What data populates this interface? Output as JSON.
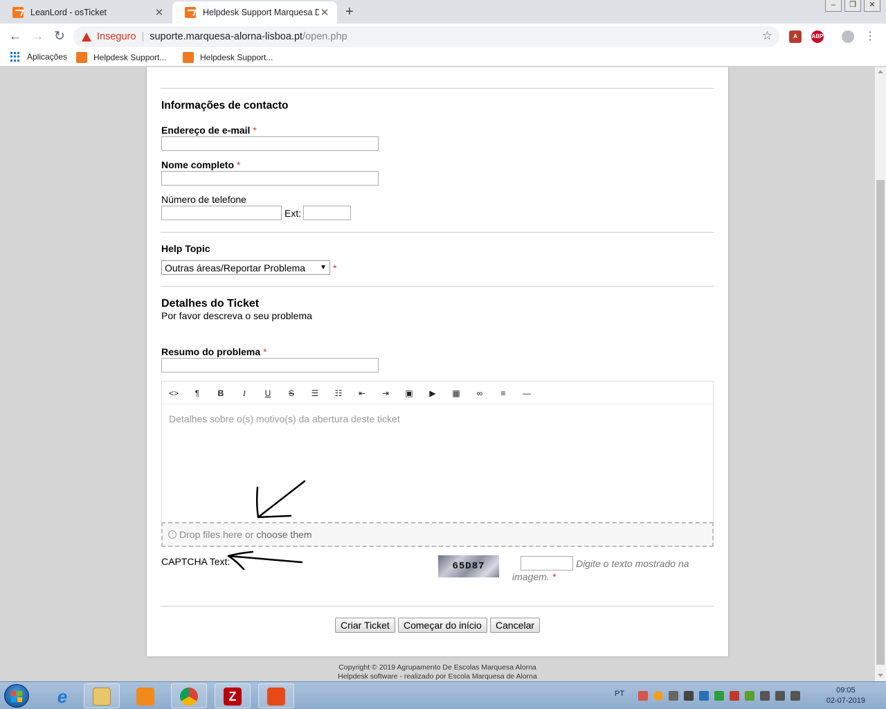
{
  "browser": {
    "tabs": [
      {
        "title": "LeanLord - osTicket",
        "active": false
      },
      {
        "title": "Helpdesk Support Marquesa De A",
        "active": true
      }
    ],
    "new_tab": "+",
    "security_label": "Inseguro",
    "url_host": "suporte.marquesa-alorna-lisboa.pt",
    "url_path": "/open.php",
    "bookmarks": [
      {
        "label": "Aplicações",
        "icon": "apps-grid-icon"
      },
      {
        "label": "Helpdesk Support...",
        "icon": "osticket-favicon"
      },
      {
        "label": "Helpdesk Support...",
        "icon": "osticket-favicon"
      }
    ],
    "extensions": {
      "abp": "ABP"
    }
  },
  "form": {
    "contact_heading": "Informações de contacto",
    "email_label": "Endereço de e-mail",
    "name_label": "Nome completo",
    "phone_label": "Número de telefone",
    "ext_label": "Ext:",
    "required_mark": "*",
    "help_topic_label": "Help Topic",
    "help_topic_selected": "Outras áreas/Reportar Problema",
    "ticket_heading": "Detalhes do Ticket",
    "ticket_subheading": "Por favor descreva o seu problema",
    "summary_label": "Resumo do problema",
    "editor_placeholder": "Detalhes sobre o(s) motivo(s) da abertura deste ticket",
    "editor_tools": [
      "code-view-icon",
      "paragraph-icon",
      "bold-icon",
      "italic-icon",
      "underline-icon",
      "strikethrough-icon",
      "bullet-list-icon",
      "numbered-list-icon",
      "outdent-icon",
      "indent-icon",
      "image-icon",
      "video-icon",
      "table-icon",
      "link-icon",
      "align-icon",
      "horizontal-rule-icon"
    ],
    "dropzone_text": "Drop files here or",
    "dropzone_link": "choose them",
    "captcha_label": "CAPTCHA Text:",
    "captcha_code": "65D87",
    "captcha_hint_1": "Digite o texto mostrado na",
    "captcha_hint_2": "imagem.",
    "buttons": {
      "submit": "Criar Ticket",
      "reset": "Começar do início",
      "cancel": "Cancelar"
    }
  },
  "footer": {
    "copyright": "Copyright © 2019 Agrupamento De Escolas Marquesa Alorna",
    "powered": "Helpdesk software - realizado por Escola Marquesa de Alorna"
  },
  "taskbar": {
    "apps": [
      "internet-explorer-icon",
      "file-explorer-icon",
      "media-player-icon",
      "chrome-icon",
      "filezilla-icon",
      "office-icon"
    ],
    "language": "PT",
    "time": "09:05",
    "date": "02-07-2019"
  },
  "colors": {
    "required": "#dd3333",
    "insecure": "#d93025",
    "page_bg": "#d5d5d5"
  }
}
